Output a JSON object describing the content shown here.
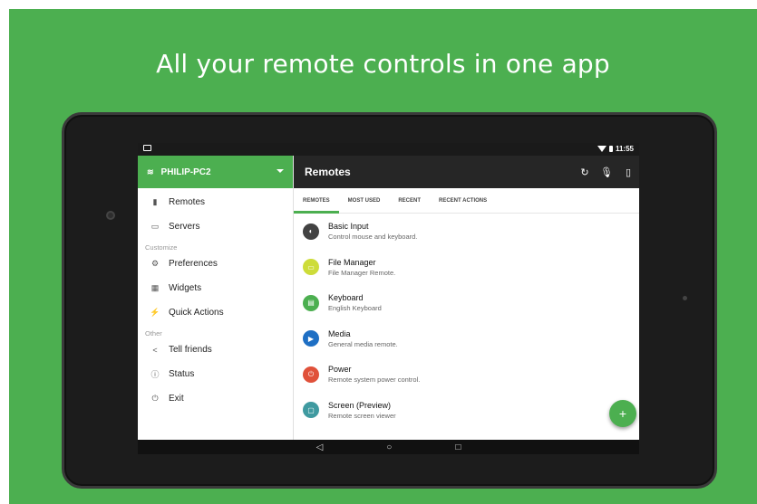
{
  "headline": "All your remote controls in one app",
  "status": {
    "time": "11:55"
  },
  "drawer": {
    "server": "PHILIP-PC2",
    "items_top": [
      {
        "label": "Remotes",
        "icon": "remotes-icon",
        "glyph": "▮"
      },
      {
        "label": "Servers",
        "icon": "monitor-icon",
        "glyph": "▭"
      }
    ],
    "section_customize": "Customize",
    "items_customize": [
      {
        "label": "Preferences",
        "icon": "gear-icon",
        "glyph": "⚙"
      },
      {
        "label": "Widgets",
        "icon": "grid-icon",
        "glyph": "▦"
      },
      {
        "label": "Quick Actions",
        "icon": "bolt-icon",
        "glyph": "⚡"
      }
    ],
    "section_other": "Other",
    "items_other": [
      {
        "label": "Tell friends",
        "icon": "share-icon",
        "glyph": "<"
      },
      {
        "label": "Status",
        "icon": "info-icon",
        "glyph": "ⓘ"
      },
      {
        "label": "Exit",
        "icon": "power-icon",
        "glyph": "⏻"
      }
    ]
  },
  "appbar": {
    "title": "Remotes"
  },
  "tabs": [
    "REMOTES",
    "MOST USED",
    "RECENT",
    "RECENT ACTIONS"
  ],
  "remotes": [
    {
      "title": "Basic Input",
      "subtitle": "Control mouse and keyboard.",
      "color": "#424242",
      "icon": "mouse-icon",
      "glyph": "◐"
    },
    {
      "title": "File Manager",
      "subtitle": "File Manager Remote.",
      "color": "#cddc39",
      "icon": "folder-icon",
      "glyph": "▭"
    },
    {
      "title": "Keyboard",
      "subtitle": "English Keyboard",
      "color": "#4caf50",
      "icon": "keyboard-icon",
      "glyph": "▤"
    },
    {
      "title": "Media",
      "subtitle": "General media remote.",
      "color": "#1e6fc4",
      "icon": "play-icon",
      "glyph": "▶"
    },
    {
      "title": "Power",
      "subtitle": "Remote system power control.",
      "color": "#e0513a",
      "icon": "power-icon",
      "glyph": "⏻"
    },
    {
      "title": "Screen (Preview)",
      "subtitle": "Remote screen viewer",
      "color": "#3f9aa0",
      "icon": "screen-icon",
      "glyph": "▢"
    }
  ]
}
